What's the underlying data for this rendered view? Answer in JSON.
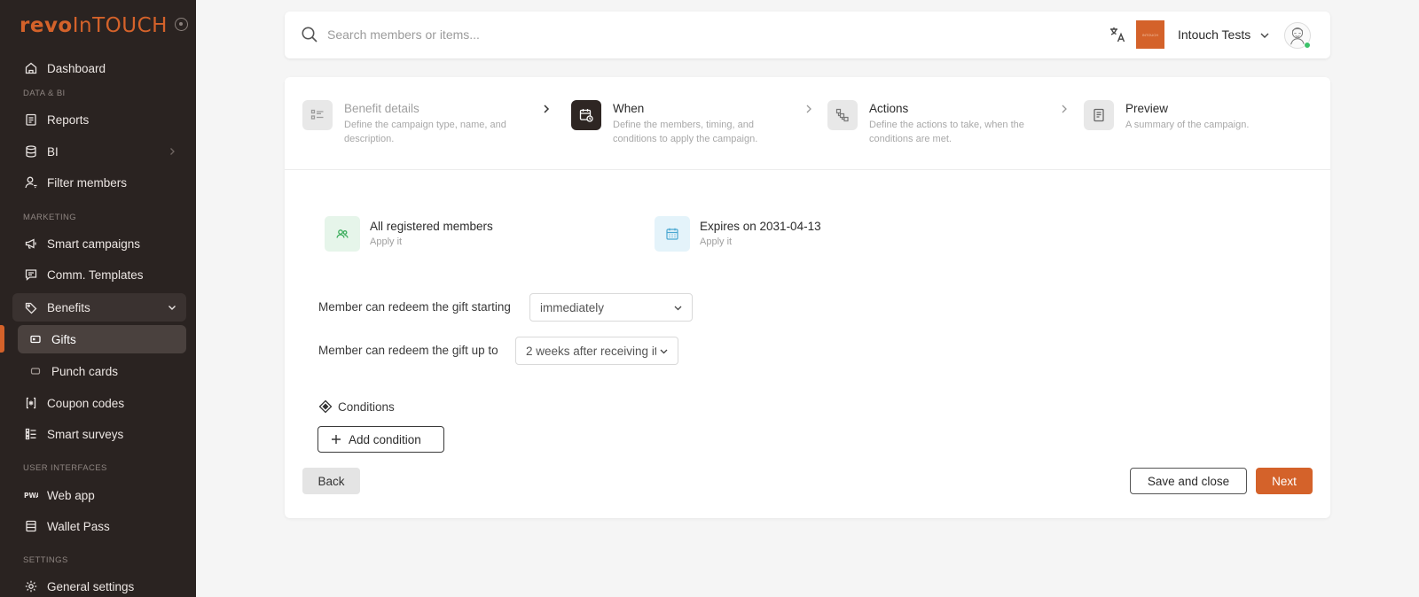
{
  "brand": {
    "logo_part1": "revo",
    "logo_part2": "InTOUCH",
    "accent": "#d4622a"
  },
  "sidebar": {
    "sections": {
      "data_bi": "DATA & BI",
      "marketing": "MARKETING",
      "user_interfaces": "USER INTERFACES",
      "settings": "SETTINGS"
    },
    "items": {
      "dashboard": "Dashboard",
      "reports": "Reports",
      "bi": "BI",
      "filter_members": "Filter members",
      "smart_campaigns": "Smart campaigns",
      "comm_templates": "Comm. Templates",
      "benefits": "Benefits",
      "gifts": "Gifts",
      "punch_cards": "Punch cards",
      "coupon_codes": "Coupon codes",
      "smart_surveys": "Smart surveys",
      "web_app": "Web app",
      "wallet_pass": "Wallet Pass",
      "general_settings": "General settings"
    }
  },
  "header": {
    "search_placeholder": "Search members or items...",
    "org_name": "Intouch Tests",
    "org_logo_text": "INTOUCH"
  },
  "stepper": {
    "steps": [
      {
        "title": "Benefit details",
        "desc": "Define the campaign type, name, and description.",
        "state": "done",
        "icon": "list-icon"
      },
      {
        "title": "When",
        "desc": "Define the members, timing, and conditions to apply the campaign.",
        "state": "current",
        "icon": "calendar-clock-icon"
      },
      {
        "title": "Actions",
        "desc": "Define the actions to take, when the conditions are met.",
        "state": "upcoming",
        "icon": "actions-icon"
      },
      {
        "title": "Preview",
        "desc": "A summary of the campaign.",
        "state": "upcoming",
        "icon": "document-icon"
      }
    ]
  },
  "summary": {
    "members": {
      "title": "All registered members",
      "sub": "Apply it",
      "color": "#e6f5ea"
    },
    "expires": {
      "title": "Expires on 2031-04-13",
      "sub": "Apply it",
      "color": "#e4f3fa"
    }
  },
  "form": {
    "start_label": "Member can redeem the gift starting",
    "start_value": "immediately",
    "end_label": "Member can redeem the gift up to",
    "end_value": "2 weeks after receiving it"
  },
  "conditions": {
    "label": "Conditions",
    "add_button": "Add condition"
  },
  "actions": {
    "back": "Back",
    "save_close": "Save and close",
    "next": "Next"
  }
}
